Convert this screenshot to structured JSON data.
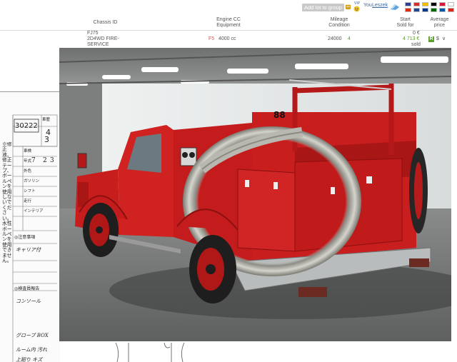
{
  "topbar": {
    "add_lot_label": "Add lot to group",
    "you_label": "You",
    "username": "Leszek",
    "icons": [
      "robot-icon",
      "smiley-icon",
      "vip-icon",
      "pin-icon"
    ],
    "flags": [
      {
        "name": "flag-gb",
        "color": "#2d3e8c"
      },
      {
        "name": "flag-ru",
        "color": "#d0312d"
      },
      {
        "name": "flag-es",
        "color": "#f1bf00"
      },
      {
        "name": "flag-de",
        "color": "#000000"
      },
      {
        "name": "flag-pl",
        "color": "#dc143c"
      },
      {
        "name": "flag-jp",
        "color": "#ffffff"
      },
      {
        "name": "flag-cn",
        "color": "#de2910"
      },
      {
        "name": "flag-nl",
        "color": "#21468b"
      },
      {
        "name": "flag-fi",
        "color": "#003580"
      },
      {
        "name": "flag-pt",
        "color": "#006600"
      },
      {
        "name": "flag-fr",
        "color": "#0055a4"
      },
      {
        "name": "flag-vn",
        "color": "#da251d"
      }
    ]
  },
  "table": {
    "headers": {
      "chassis": "Chassis ID",
      "engine_line1": "Engine CC",
      "engine_line2": "Equipment",
      "mileage_line1": "Mileage",
      "mileage_line2": "Condition",
      "start_line1": "Start",
      "start_line2": "Sold for",
      "avg_line1": "Average",
      "avg_line2": "price"
    },
    "row": {
      "chassis_line1": "FJ75",
      "chassis_line2": "2D4WD FIRE-",
      "chassis_line3": "SERVICE",
      "engine_prefix": "F5",
      "engine_cc": "4000 cc",
      "mileage": "24000",
      "condition": "4",
      "start_price": "0 €",
      "sold_price": "4 713 €",
      "sold_status": "sold",
      "result_badge": "R",
      "currency_badge": "$",
      "dropdown_arrow": "∨"
    },
    "colors": {
      "engine_prefix": "#d9534f",
      "condition": "#5aa02c",
      "sold": "#5aa02c",
      "header_text": "#555555"
    }
  },
  "sheet": {
    "lot_number": "30222",
    "lines": [
      "車歴",
      "車検",
      "年式",
      "外色",
      "ガソリン",
      "シフト",
      "走行",
      "インテリア",
      "◎注意事項",
      "◎検査員報告"
    ],
    "handwritten": [
      "4",
      "3",
      "7",
      "2",
      "3",
      "キャリア付",
      "コンソール",
      "グローブ BOX",
      "ルーム内 汚れ",
      "上廻り キズ"
    ],
    "vertical_note": "※修正液、修正テープ、ボールペンを使用しないでください。水性ボールペンを使用できません。"
  },
  "photo": {
    "subject": "red-fire-truck",
    "plate_text": "88"
  }
}
